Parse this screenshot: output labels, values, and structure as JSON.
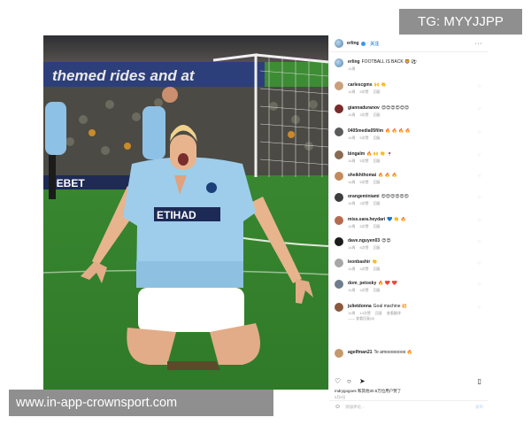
{
  "overlay": {
    "tg_badge": "TG: MYYJJPP",
    "site_banner": "www.in-app-crownsport.com"
  },
  "photo": {
    "board_text": "themed rides and at",
    "sponsor_text": "DEBET",
    "shirt_text": "ETIHAD"
  },
  "post": {
    "header": {
      "username": "erling",
      "follow": "关注",
      "more": "···"
    },
    "caption": {
      "username": "erling",
      "text": "FOOTBALL IS BACK 🦁 ⚽",
      "meta": "14周"
    },
    "comments": [
      {
        "user": "carlescgms",
        "text": "🙌 👏",
        "time": "14周",
        "likes": "5次赞",
        "reply": "回复",
        "avatar": "#c9a07a"
      },
      {
        "user": "giannaduranov",
        "text": "😍😍😍😍😍😍",
        "time": "14周",
        "likes": "3次赞",
        "reply": "回复",
        "avatar": "#7a2b2b"
      },
      {
        "user": "0405media05film",
        "text": "🔥 🔥 🔥 🔥",
        "time": "14周",
        "likes": "5次赞",
        "reply": "回复",
        "avatar": "#5b5b5b"
      },
      {
        "user": "bingalm",
        "text": "🔥 🙌 👏 🍷",
        "time": "14周",
        "likes": "5次赞",
        "reply": "回复",
        "avatar": "#8a6b52"
      },
      {
        "user": "sheikhthomai",
        "text": "🔥 🔥 🔥",
        "time": "14周",
        "likes": "5次赞",
        "reply": "回复",
        "avatar": "#c58a5b"
      },
      {
        "user": "orangeminiami",
        "text": "😍😍😍😍😍😍",
        "time": "14周",
        "likes": "4次赞",
        "reply": "回复",
        "avatar": "#3d3d3d"
      },
      {
        "user": "miss.sara.heydari",
        "text": "💙 👏 🔥",
        "time": "14周",
        "likes": "5次赞",
        "reply": "回复",
        "avatar": "#b56a4e"
      },
      {
        "user": "dave.nguyen03",
        "text": "😍😍",
        "time": "14周",
        "likes": "5次赞",
        "reply": "回复",
        "avatar": "#1c1c1c"
      },
      {
        "user": "leonbashir",
        "text": "👏",
        "time": "14周",
        "likes": "4次赞",
        "reply": "回复",
        "avatar": "#a7a7a7"
      },
      {
        "user": "dom_petosky",
        "text": "🔥 ❤️ ❤️",
        "time": "14周",
        "likes": "4次赞",
        "reply": "回复",
        "avatar": "#6f7d8c"
      },
      {
        "user": "julietdonna",
        "text": "Goal machine 💥",
        "time": "14周",
        "likes": "14次赞",
        "reply": "回复",
        "extra": "查看翻译",
        "avatar": "#8b5a3c",
        "replies": "—— 查看回复(8)"
      },
      {
        "user": "agelfman21",
        "text": "Te amoooooooo 🔥",
        "time": "",
        "likes": "",
        "reply": "",
        "avatar": "#c49a6c"
      }
    ],
    "liked_by": "mdrygogoes 和其他30.5万位用户赞了",
    "post_time": "5月9日",
    "add_comment_placeholder": "添加评论...",
    "post_button": "发布"
  }
}
